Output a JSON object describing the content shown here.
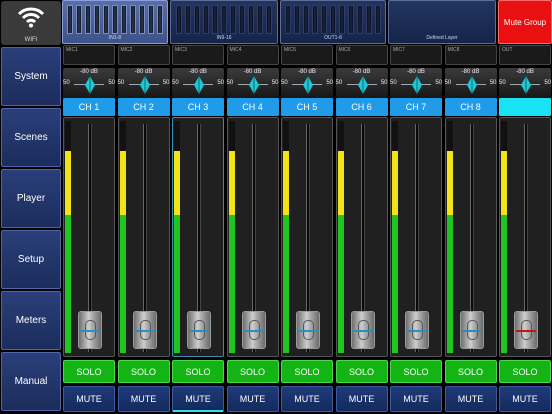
{
  "sidebar": {
    "wifi_label": "WIFI",
    "items": [
      {
        "label": "System"
      },
      {
        "label": "Scenes"
      },
      {
        "label": "Player"
      },
      {
        "label": "Setup"
      },
      {
        "label": "Meters"
      },
      {
        "label": "Manual"
      }
    ]
  },
  "banks": [
    {
      "label": "IN1-8",
      "active": true
    },
    {
      "label": "IN9-16",
      "active": false
    },
    {
      "label": "OUT1-8",
      "active": false
    },
    {
      "label": "Defined Layer",
      "active": false
    }
  ],
  "mute_group_label": "Mute Group",
  "colors": {
    "channel_name": "#1f9bea",
    "solo": "#15b415",
    "mute": "#1f3a78",
    "mute_group": "#e81010",
    "meter_yellow": "#f1e515",
    "meter_green": "#21c421"
  },
  "channels": [
    {
      "source": "MIC1",
      "db": "-80 dB",
      "pan_left": "50",
      "pan_right": "50",
      "name": "CH 1",
      "solo": "SOLO",
      "mute": "MUTE"
    },
    {
      "source": "MIC2",
      "db": "-80 dB",
      "pan_left": "50",
      "pan_right": "50",
      "name": "CH 2",
      "solo": "SOLO",
      "mute": "MUTE"
    },
    {
      "source": "MIC3",
      "db": "-80 dB",
      "pan_left": "50",
      "pan_right": "50",
      "name": "CH 3",
      "solo": "SOLO",
      "mute": "MUTE"
    },
    {
      "source": "MIC4",
      "db": "-80 dB",
      "pan_left": "50",
      "pan_right": "50",
      "name": "CH 4",
      "solo": "SOLO",
      "mute": "MUTE"
    },
    {
      "source": "MIC5",
      "db": "-80 dB",
      "pan_left": "50",
      "pan_right": "50",
      "name": "CH 5",
      "solo": "SOLO",
      "mute": "MUTE"
    },
    {
      "source": "MIC6",
      "db": "-80 dB",
      "pan_left": "50",
      "pan_right": "50",
      "name": "CH 6",
      "solo": "SOLO",
      "mute": "MUTE"
    },
    {
      "source": "MIC7",
      "db": "-80 dB",
      "pan_left": "50",
      "pan_right": "50",
      "name": "CH 7",
      "solo": "SOLO",
      "mute": "MUTE"
    },
    {
      "source": "MIC8",
      "db": "-80 dB",
      "pan_left": "50",
      "pan_right": "50",
      "name": "CH 8",
      "solo": "SOLO",
      "mute": "MUTE"
    }
  ],
  "output": {
    "source": "OUT",
    "db": "-80 dB",
    "pan_left": "50",
    "pan_right": "50",
    "name": "",
    "solo": "SOLO",
    "mute": "MUTE"
  }
}
